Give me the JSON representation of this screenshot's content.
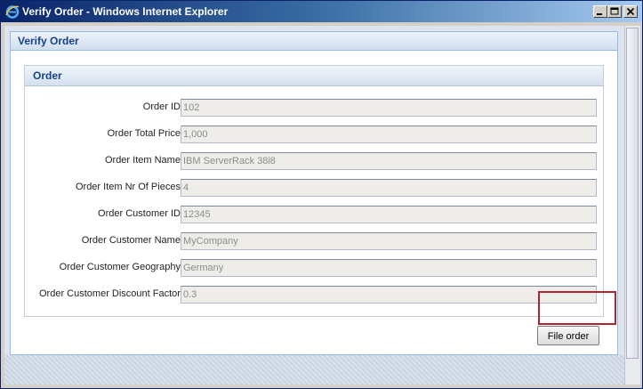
{
  "window": {
    "title": "Verify Order - Windows Internet Explorer"
  },
  "panel": {
    "title": "Verify Order"
  },
  "fieldset": {
    "title": "Order"
  },
  "fields": [
    {
      "label": "Order ID:",
      "value": "102"
    },
    {
      "label": "Order Total Price:",
      "value": "1,000"
    },
    {
      "label": "Order Item Name:",
      "value": "IBM ServerRack 38i8"
    },
    {
      "label": "Order Item Nr Of Pieces:",
      "value": "4"
    },
    {
      "label": "Order Customer ID:",
      "value": "12345"
    },
    {
      "label": "Order Customer Name:",
      "value": "MyCompany"
    },
    {
      "label": "Order Customer Geography:",
      "value": "Germany"
    },
    {
      "label": "Order Customer Discount Factor:",
      "value": "0.3"
    }
  ],
  "actions": {
    "file_order_label": "File order"
  },
  "colors": {
    "titlebar_start": "#0a246a",
    "panel_border": "#99bbe8",
    "highlight": "#b0242f"
  }
}
